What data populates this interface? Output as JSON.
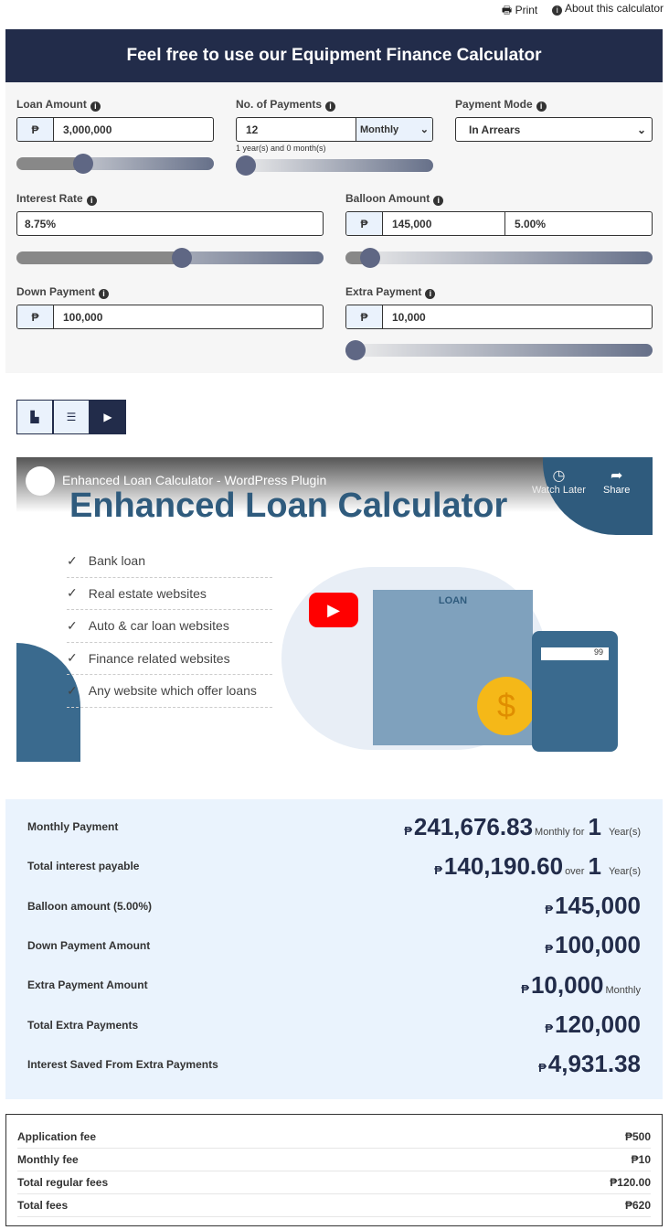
{
  "top_links": {
    "print": "Print",
    "about": "About this calculator"
  },
  "header": {
    "title": "Feel free to use our Equipment Finance Calculator"
  },
  "form": {
    "currency": "₱",
    "loan_amount": {
      "label": "Loan Amount",
      "value": "3,000,000",
      "slider_percent": 32
    },
    "payments": {
      "label": "No. of Payments",
      "value": "12",
      "frequency": "Monthly",
      "note": "1 year(s) and 0 month(s)",
      "slider_percent": 0
    },
    "payment_mode": {
      "label": "Payment Mode",
      "value": "In Arrears"
    },
    "interest_rate": {
      "label": "Interest Rate",
      "value": "8.75%",
      "slider_percent": 54
    },
    "balloon": {
      "label": "Balloon Amount",
      "value": "145,000",
      "percent": "5.00%",
      "slider_percent": 5
    },
    "down_payment": {
      "label": "Down Payment",
      "value": "100,000"
    },
    "extra_payment": {
      "label": "Extra Payment",
      "value": "10,000",
      "slider_percent": 0
    }
  },
  "tabs": [
    {
      "icon": "chart-icon"
    },
    {
      "icon": "list-icon"
    },
    {
      "icon": "play-icon",
      "active": true
    }
  ],
  "video": {
    "title": "Enhanced Loan Calculator - WordPress Plugin",
    "watch_later": "Watch Later",
    "share": "Share",
    "heading": "Enhanced Loan Calculator",
    "bullets": [
      "Bank loan",
      "Real estate websites",
      "Auto & car loan websites",
      "Finance related websites",
      "Any website which offer loans"
    ],
    "sign": "LOAN",
    "calc_display": "99"
  },
  "results": [
    {
      "label": "Monthly Payment",
      "value": "241,676.83",
      "suffix": "Monthly for",
      "num": "1",
      "unit": "Year(s)"
    },
    {
      "label": "Total interest payable",
      "value": "140,190.60",
      "suffix": "over",
      "num": "1",
      "unit": "Year(s)"
    },
    {
      "label": "Balloon amount (5.00%)",
      "value": "145,000"
    },
    {
      "label": "Down Payment Amount",
      "value": "100,000"
    },
    {
      "label": "Extra Payment Amount",
      "value": "10,000",
      "suffix": "Monthly"
    },
    {
      "label": "Total Extra Payments",
      "value": "120,000"
    },
    {
      "label": "Interest Saved From Extra Payments",
      "value": "4,931.38"
    }
  ],
  "fees": [
    {
      "label": "Application fee",
      "value": "₱500"
    },
    {
      "label": "Monthly fee",
      "value": "₱10"
    },
    {
      "label": "Total regular fees",
      "value": "₱120.00"
    },
    {
      "label": "Total fees",
      "value": "₱620"
    }
  ],
  "colors": {
    "primary": "#222c4a",
    "light": "#eaf3fd",
    "youtube": "#ff0000"
  }
}
